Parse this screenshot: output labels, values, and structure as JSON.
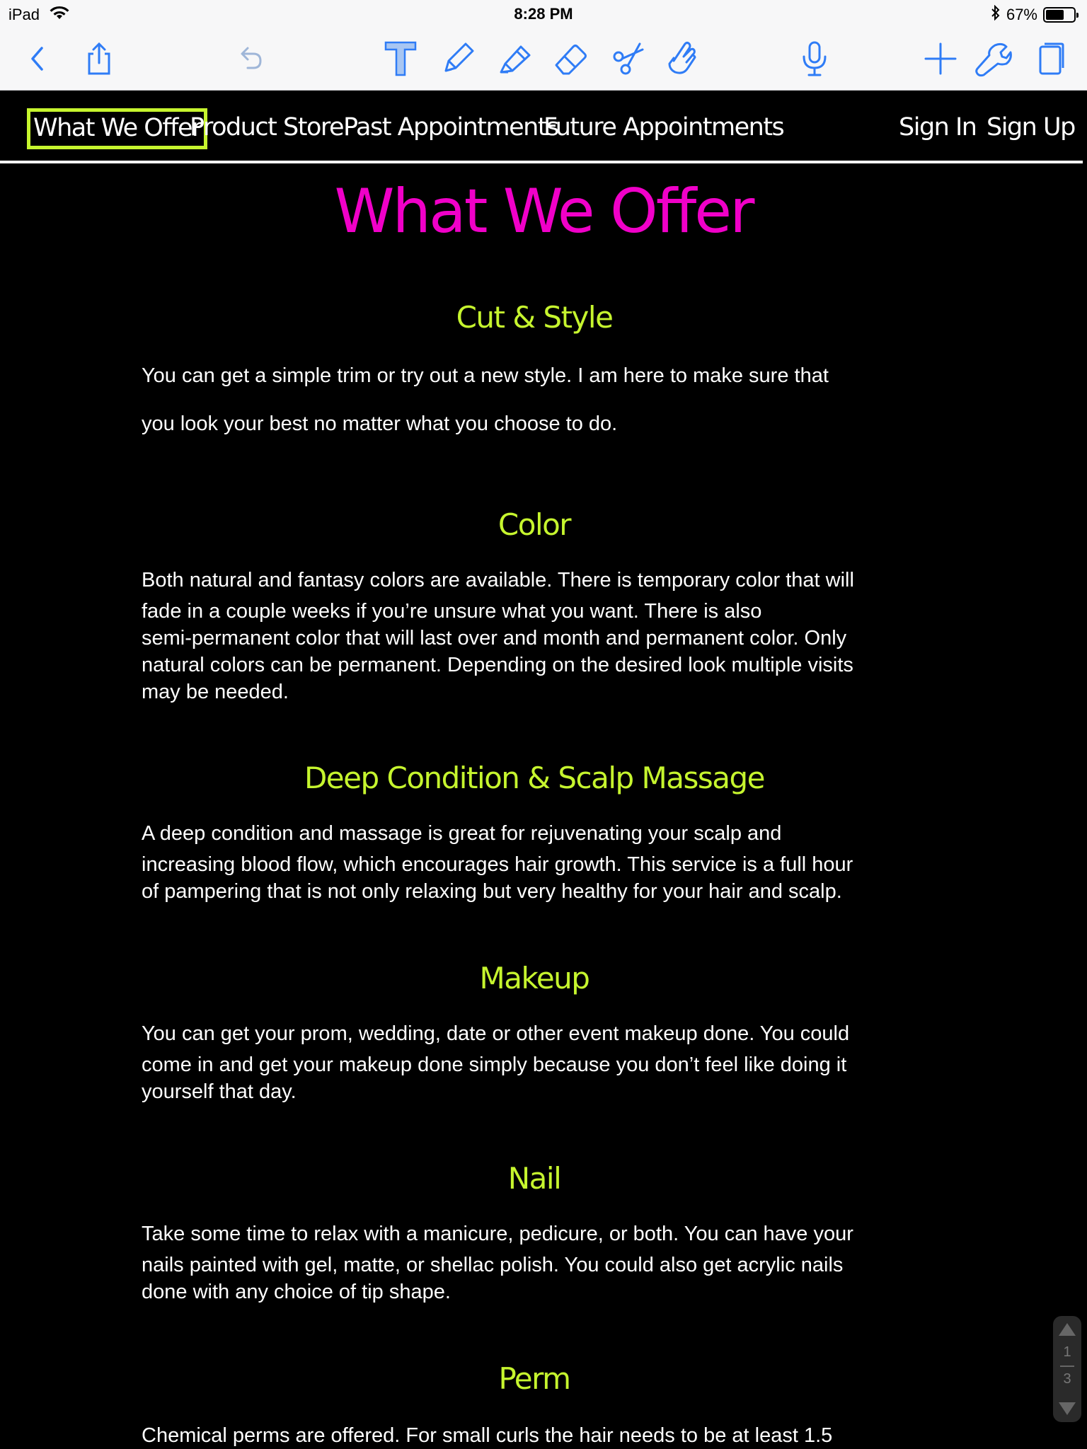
{
  "status_bar": {
    "device": "iPad",
    "time": "8:28 PM",
    "battery": "67%",
    "battery_level": 0.67
  },
  "toolbar": {
    "icons": [
      "back-icon",
      "share-icon",
      "undo-icon",
      "text-tool-icon",
      "pencil-icon",
      "highlighter-icon",
      "eraser-icon",
      "scissors-icon",
      "hand-pointer-icon",
      "microphone-icon",
      "add-icon",
      "wrench-icon",
      "pages-icon"
    ]
  },
  "nav": {
    "items": [
      "What We Offer",
      "Product Store",
      "Past Appointments",
      "Future Appointments"
    ],
    "sign_in": "Sign In",
    "sign_up": "Sign Up",
    "active_color": "#c6f52e"
  },
  "page": {
    "title": "What We Offer",
    "title_color": "#f000c8",
    "heading_color": "#c6f52e"
  },
  "sections": [
    {
      "title": "Cut & Style",
      "lines": [
        "You can get a simple trim or try out a new style. I am here to make sure that",
        "you look your best no matter what you choose to do."
      ]
    },
    {
      "title": "Color",
      "lines": [
        "Both natural and fantasy colors are available. There is temporary color that will",
        "fade in a couple weeks if you’re unsure what you want. There is also",
        "semi-permanent color that will last over and month and permanent color. Only",
        "natural colors can be permanent. Depending on the desired look multiple visits",
        "may be needed."
      ]
    },
    {
      "title": "Deep Condition & Scalp Massage",
      "lines": [
        "A deep condition and massage is great for rejuvenating your scalp and",
        "increasing blood flow, which encourages hair growth. This service is a full hour",
        "of pampering that is not only relaxing but very healthy for your hair and scalp."
      ]
    },
    {
      "title": "Makeup",
      "lines": [
        "You can get your prom, wedding, date or other event makeup done. You could",
        "come in and get your makeup done simply because you don’t feel like doing it",
        "yourself that day."
      ]
    },
    {
      "title": "Nail",
      "lines": [
        "Take some time to relax with a manicure, pedicure, or both. You can have your",
        "nails painted with gel, matte, or shellac polish. You could also get acrylic nails",
        "done with any choice of tip shape."
      ]
    },
    {
      "title": "Perm",
      "lines": [
        "Chemical perms are offered. For small curls the hair needs to be at least 1.5"
      ]
    }
  ],
  "scroller": {
    "current_page": "1",
    "total_pages": "3"
  }
}
